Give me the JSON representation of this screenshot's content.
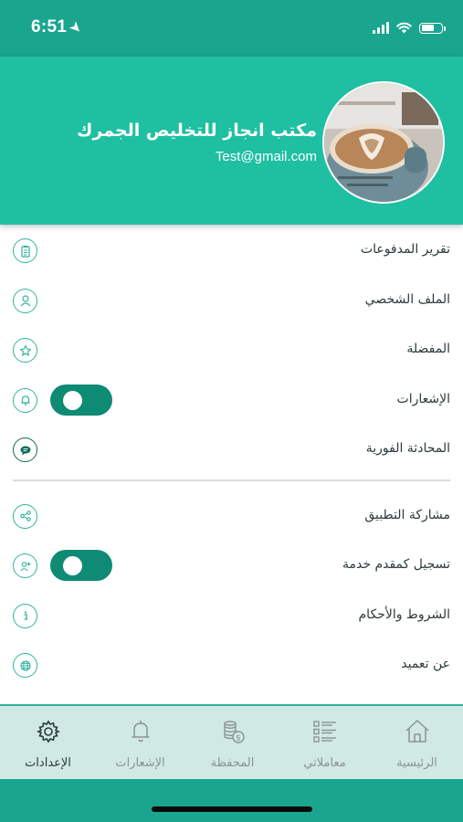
{
  "status_bar": {
    "time": "6:51"
  },
  "profile": {
    "name": "مكتب انجاز للتخليص الجمرك",
    "email": "Test@gmail.com"
  },
  "menu": {
    "items": [
      {
        "label": "تقرير المدفوعات",
        "icon": "clipboard-icon"
      },
      {
        "label": "الملف الشخصي",
        "icon": "user-icon"
      },
      {
        "label": "المفضلة",
        "icon": "star-icon"
      },
      {
        "label": "الإشعارات",
        "icon": "bell-icon",
        "toggle": true
      },
      {
        "label": "المحادثة الفورية",
        "icon": "chat-icon"
      },
      {
        "label": "مشاركة التطبيق",
        "icon": "share-icon"
      },
      {
        "label": "تسجيل كمقدم خدمة",
        "icon": "user-plus-icon",
        "toggle": true
      },
      {
        "label": "الشروط والأحكام",
        "icon": "info-icon"
      },
      {
        "label": "عن تعميد",
        "icon": "globe-icon"
      }
    ]
  },
  "tabs": [
    {
      "label": "الإعدادات",
      "icon": "gear-icon",
      "active": true
    },
    {
      "label": "الإشعارات",
      "icon": "bell-icon",
      "active": false
    },
    {
      "label": "المحفظة",
      "icon": "coins-icon",
      "active": false
    },
    {
      "label": "معاملاتي",
      "icon": "list-icon",
      "active": false
    },
    {
      "label": "الرئيسية",
      "icon": "home-icon",
      "active": false
    }
  ],
  "colors": {
    "header": "#1fbfa2",
    "status_bar": "#1aa58f",
    "toggle": "#0f8a74",
    "icon_stroke": "#2fb59c",
    "tabbar": "#d1e9e5"
  }
}
